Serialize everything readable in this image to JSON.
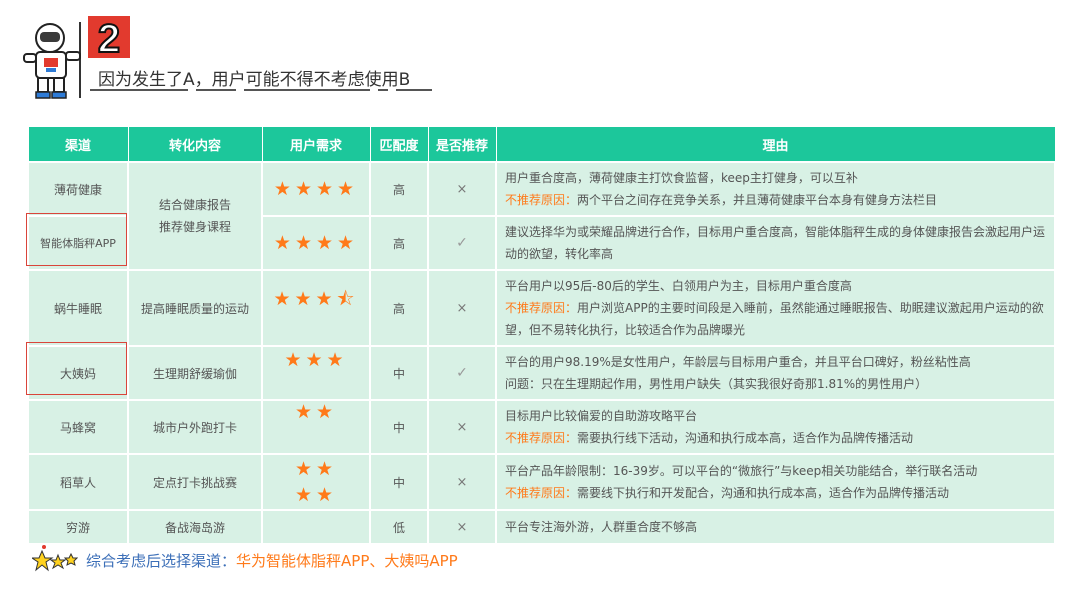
{
  "header": {
    "number": "2",
    "title": "因为发生了A，用户可能不得不考虑使用B"
  },
  "table": {
    "columns": [
      "渠道",
      "转化内容",
      "用户需求",
      "匹配度",
      "是否推荐",
      "理由"
    ],
    "rows": [
      {
        "channel": "薄荷健康",
        "stars": "★★★★",
        "match": "高",
        "recommend": "×",
        "reason_line1": "用户重合度高，薄荷健康主打饮食监督，keep主打健身，可以互补",
        "reason_prefix2": "不推荐原因：",
        "reason_line2": "两个平台之间存在竞争关系，并且薄荷健康平台本身有健身方法栏目"
      },
      {
        "channel": "智能体脂秤APP",
        "stars": "★★★★",
        "match": "高",
        "recommend": "✓",
        "reason_line1": "建议选择华为或荣耀品牌进行合作，目标用户重合度高，智能体脂秤生成的身体健康报告会激起用户运动的欲望，转化率高"
      },
      {
        "channel": "蜗牛睡眠",
        "content": "提高睡眠质量的运动",
        "stars": "★★★⯪",
        "match": "高",
        "recommend": "×",
        "reason_line1": "平台用户以95后-80后的学生、白领用户为主，目标用户重合度高",
        "reason_prefix2": "不推荐原因：",
        "reason_line2": "用户浏览APP的主要时间段是入睡前，虽然能通过睡眠报告、助眠建议激起用户运动的欲望，但不易转化执行，比较适合作为品牌曝光"
      },
      {
        "channel": "大姨妈",
        "content": "生理期舒缓瑜伽",
        "stars": "★★★",
        "match": "中",
        "recommend": "✓",
        "reason_line1": "平台的用户98.19%是女性用户，年龄层与目标用户重合，并且平台口碑好，粉丝粘性高",
        "reason_line2": "问题：只在生理期起作用，男性用户缺失（其实我很好奇那1.81%的男性用户）"
      },
      {
        "channel": "马蜂窝",
        "content": "城市户外跑打卡",
        "stars": "★★",
        "match": "中",
        "recommend": "×",
        "reason_line1": "目标用户比较偏爱的自助游攻略平台",
        "reason_prefix2": "不推荐原因：",
        "reason_line2": "需要执行线下活动，沟通和执行成本高，适合作为品牌传播活动"
      },
      {
        "channel": "稻草人",
        "content": "定点打卡挑战赛",
        "stars_top": "★★",
        "stars_bottom": "★★",
        "match": "中",
        "recommend": "×",
        "reason_line1": "平台产品年龄限制：16-39岁。可以平台的“微旅行”与keep相关功能结合，举行联名活动",
        "reason_prefix2": "不推荐原因：",
        "reason_line2": "需要线下执行和开发配合，沟通和执行成本高，适合作为品牌传播活动"
      },
      {
        "channel": "穷游",
        "content": "备战海岛游",
        "stars": "",
        "match": "低",
        "recommend": "×",
        "reason_line1": "平台专注海外游，人群重合度不够高"
      }
    ],
    "merged_content": "结合健康报告\n推荐健身课程",
    "merged_content_line1": "结合健康报告",
    "merged_content_line2": "推荐健身课程"
  },
  "conclusion": {
    "label": "综合考虑后选择渠道：",
    "value": "华为智能体脂秤APP、大姨吗APP"
  },
  "colors": {
    "header_green": "#1cc79b",
    "row_bg": "#d8f1e5",
    "accent_orange": "#ff7a1a",
    "highlight_red": "#d9453a",
    "conclusion_blue": "#3c6fb8"
  }
}
